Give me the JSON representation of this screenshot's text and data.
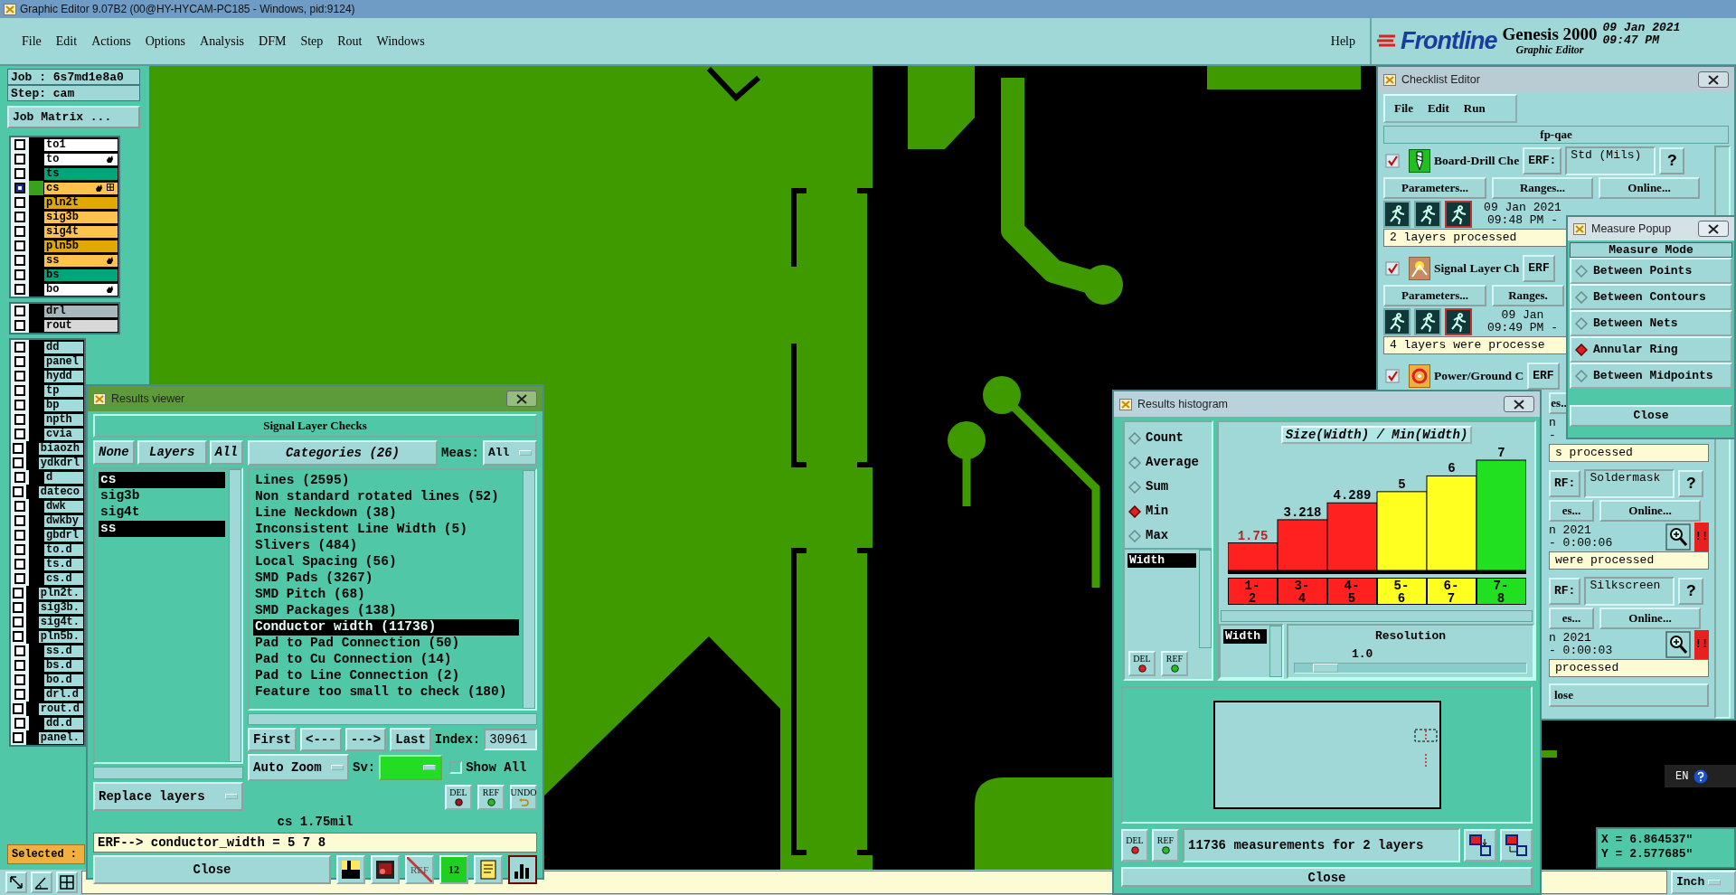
{
  "window": {
    "title": "Graphic Editor 9.07B2 (00@HY-HYCAM-PC185 - Windows, pid:9124)"
  },
  "menu": [
    "File",
    "Edit",
    "Actions",
    "Options",
    "Analysis",
    "DFM",
    "Step",
    "Rout",
    "Windows"
  ],
  "help_menu": "Help",
  "brand": {
    "logo": "Frontline",
    "product": "Genesis 2000",
    "subtitle": "Graphic Editor",
    "date": "09 Jan 2021",
    "time": "09:47 PM"
  },
  "job": {
    "job": "Job : 6s7md1e8a0",
    "step": "Step: cam",
    "matrix_button": "Job Matrix ..."
  },
  "layer_groups": [
    [
      {
        "name": "to1",
        "color": "#ffffff",
        "hand": false,
        "work": false
      },
      {
        "name": "to",
        "color": "#ffffff",
        "hand": true,
        "work": false
      },
      {
        "name": "ts",
        "color": "#00a57a",
        "hand": false,
        "work": false
      },
      {
        "name": "cs",
        "color": "#ffc34d",
        "hand": true,
        "work": true
      },
      {
        "name": "pln2t",
        "color": "#e0a800",
        "hand": false,
        "work": false
      },
      {
        "name": "sig3b",
        "color": "#ffc34d",
        "hand": false,
        "work": false
      },
      {
        "name": "sig4t",
        "color": "#ffc34d",
        "hand": false,
        "work": false
      },
      {
        "name": "pln5b",
        "color": "#e0a800",
        "hand": false,
        "work": false
      },
      {
        "name": "ss",
        "color": "#ffc34d",
        "hand": true,
        "work": false
      },
      {
        "name": "bs",
        "color": "#00a57a",
        "hand": false,
        "work": false
      },
      {
        "name": "bo",
        "color": "#ffffff",
        "hand": true,
        "work": false
      }
    ],
    [
      {
        "name": "drl",
        "color": "#a7b8bd",
        "hand": false,
        "work": false
      },
      {
        "name": "rout",
        "color": "#d8d8d8",
        "hand": false,
        "work": false
      }
    ],
    [
      {
        "name": "dd",
        "color": "#a0dcdc",
        "hand": false,
        "work": false
      },
      {
        "name": "panel",
        "color": "#a0dcdc",
        "hand": false,
        "work": false
      },
      {
        "name": "hydd",
        "color": "#a0dcdc",
        "hand": false,
        "work": false
      },
      {
        "name": "tp",
        "color": "#a0dcdc",
        "hand": false,
        "work": false
      },
      {
        "name": "bp",
        "color": "#a0dcdc",
        "hand": false,
        "work": false
      },
      {
        "name": "npth",
        "color": "#a0dcdc",
        "hand": false,
        "work": false
      },
      {
        "name": "cvia",
        "color": "#a0dcdc",
        "hand": false,
        "work": false
      },
      {
        "name": "biaozh",
        "color": "#a0dcdc",
        "hand": false,
        "work": false
      },
      {
        "name": "ydkdrl",
        "color": "#a0dcdc",
        "hand": false,
        "work": false
      },
      {
        "name": "d",
        "color": "#a0dcdc",
        "hand": false,
        "work": false
      },
      {
        "name": "dateco",
        "color": "#a0dcdc",
        "hand": false,
        "work": false
      },
      {
        "name": "dwk",
        "color": "#a0dcdc",
        "hand": false,
        "work": false
      },
      {
        "name": "dwkby",
        "color": "#a0dcdc",
        "hand": false,
        "work": false
      },
      {
        "name": "gbdrl",
        "color": "#a0dcdc",
        "hand": false,
        "work": false
      },
      {
        "name": "to.d",
        "color": "#a0dcdc",
        "hand": false,
        "work": false
      },
      {
        "name": "ts.d",
        "color": "#a0dcdc",
        "hand": false,
        "work": false
      },
      {
        "name": "cs.d",
        "color": "#a0dcdc",
        "hand": false,
        "work": false
      },
      {
        "name": "pln2t.",
        "color": "#a0dcdc",
        "hand": false,
        "work": false
      },
      {
        "name": "sig3b.",
        "color": "#a0dcdc",
        "hand": false,
        "work": false
      },
      {
        "name": "sig4t.",
        "color": "#a0dcdc",
        "hand": false,
        "work": false
      },
      {
        "name": "pln5b.",
        "color": "#a0dcdc",
        "hand": false,
        "work": false
      },
      {
        "name": "ss.d",
        "color": "#a0dcdc",
        "hand": false,
        "work": false
      },
      {
        "name": "bs.d",
        "color": "#a0dcdc",
        "hand": false,
        "work": false
      },
      {
        "name": "bo.d",
        "color": "#a0dcdc",
        "hand": false,
        "work": false
      },
      {
        "name": "drl.d",
        "color": "#a0dcdc",
        "hand": false,
        "work": false
      },
      {
        "name": "rout.d",
        "color": "#a0dcdc",
        "hand": false,
        "work": false
      },
      {
        "name": "dd.d",
        "color": "#a0dcdc",
        "hand": false,
        "work": false
      },
      {
        "name": "panel.",
        "color": "#a0dcdc",
        "hand": false,
        "work": false
      }
    ]
  ],
  "selected_label": "Selected :",
  "checklist_editor": {
    "title": "Checklist Editor",
    "menu": [
      "File",
      "Edit",
      "Run"
    ],
    "checklist": "fp-qae",
    "sections": [
      {
        "head": {
          "cut": false,
          "checked": true,
          "kind": "drill",
          "name": "Board-Drill Che",
          "erf_label": "ERF:",
          "erf": "Std (Mils)",
          "help": "?"
        },
        "buttons": {
          "cut": false,
          "items": [
            "Parameters...",
            "Ranges...",
            "Online..."
          ]
        },
        "run": {
          "cut": false,
          "date": "09 Jan 2021",
          "time": "09:48 PM -"
        },
        "status": {
          "cut": false,
          "text": "2 layers processed"
        }
      },
      {
        "head": {
          "cut": false,
          "checked": true,
          "kind": "signal",
          "name": "Signal Layer Ch",
          "erf_label": "ERF"
        },
        "buttons": {
          "cut": false,
          "items": [
            "Parameters...",
            "Ranges."
          ]
        },
        "run": {
          "cut": false,
          "date": "09 Jan",
          "time": "09:49 PM -"
        },
        "status": {
          "cut": false,
          "text": "4 layers were processe"
        }
      },
      {
        "head": {
          "cut": false,
          "checked": true,
          "kind": "power",
          "name": "Power/Ground C",
          "erf_label": "ERF"
        },
        "buttons": {
          "cut": true,
          "items": [
            "es.."
          ]
        },
        "run": {
          "cut": true,
          "date": "n",
          "time": "-"
        },
        "status": {
          "cut": true,
          "text": "s processed"
        }
      },
      {
        "head": {
          "cut": true,
          "erf_label": "RF:",
          "erf": "Soldermask",
          "help": "?"
        },
        "buttons": {
          "cut": true,
          "items": [
            "es...",
            "Online..."
          ]
        },
        "run": {
          "cut": true,
          "date": "n 2021",
          "time": "- 0:00:06",
          "alert": "!!"
        },
        "status": {
          "cut": true,
          "text": "were processed"
        }
      },
      {
        "head": {
          "cut": true,
          "erf_label": "RF:",
          "erf": "Silkscreen",
          "help": "?"
        },
        "buttons": {
          "cut": true,
          "items": [
            "es...",
            "Online..."
          ]
        },
        "run": {
          "cut": true,
          "date": "n 2021",
          "time": "- 0:00:03",
          "alert": "!!"
        },
        "status": {
          "cut": true,
          "text": "processed"
        }
      }
    ],
    "close": "lose"
  },
  "measure_popup": {
    "title": "Measure Popup",
    "header": "Measure Mode",
    "modes": [
      {
        "label": "Between Points",
        "selected": false
      },
      {
        "label": "Between Contours",
        "selected": false
      },
      {
        "label": "Between Nets",
        "selected": false
      },
      {
        "label": "Annular Ring",
        "selected": true
      },
      {
        "label": "Between Midpoints",
        "selected": false
      }
    ],
    "close": "Close"
  },
  "results_viewer": {
    "title": "Results viewer",
    "header": "Signal Layer Checks",
    "layer_buttons": [
      "None",
      "Layers",
      "All"
    ],
    "layers": [
      {
        "name": "cs",
        "selected": true
      },
      {
        "name": "sig3b",
        "selected": false
      },
      {
        "name": "sig4t",
        "selected": false
      },
      {
        "name": "ss",
        "selected": true
      }
    ],
    "replace": "Replace layers",
    "categories_button": "Categories (26)",
    "meas_label": "Meas:",
    "meas_value": "All",
    "categories": [
      {
        "name": "Lines (2595)",
        "selected": false
      },
      {
        "name": "Non standard rotated lines (52)",
        "selected": false
      },
      {
        "name": "Line Neckdown (38)",
        "selected": false
      },
      {
        "name": "Inconsistent Line Width (5)",
        "selected": false
      },
      {
        "name": "Slivers (484)",
        "selected": false
      },
      {
        "name": "Local Spacing (56)",
        "selected": false
      },
      {
        "name": "SMD Pads (3267)",
        "selected": false
      },
      {
        "name": "SMD Pitch (68)",
        "selected": false
      },
      {
        "name": "SMD Packages (138)",
        "selected": false
      },
      {
        "name": "Conductor width (11736)",
        "selected": true
      },
      {
        "name": "Pad to Pad Connection (50)",
        "selected": false
      },
      {
        "name": "Pad to Cu Connection (14)",
        "selected": false
      },
      {
        "name": "Pad to Line Connection (2)",
        "selected": false
      },
      {
        "name": "Feature too small to check (180)",
        "selected": false
      }
    ],
    "nav": [
      "First",
      "<---",
      "--->",
      "Last"
    ],
    "index_label": "Index:",
    "index": "30961",
    "zoom": "Auto Zoom",
    "sv_label": "Sv:",
    "show_all": {
      "label": "Show All",
      "checked": false
    },
    "edit_buttons": [
      {
        "kind": "del",
        "label": "DEL"
      },
      {
        "kind": "ref",
        "label": "REF"
      },
      {
        "kind": "undo",
        "label": "UNDO"
      }
    ],
    "measurement": "cs 1.75mil",
    "erf": "ERF--> conductor_width = 5 7 8",
    "close": "Close",
    "tools": [
      {
        "kind": "layer",
        "selected": false
      },
      {
        "kind": "erase",
        "selected": false
      },
      {
        "kind": "ref_off",
        "label": "REF",
        "selected": false
      },
      {
        "kind": "numbers",
        "label": "12",
        "selected": false
      },
      {
        "kind": "report",
        "selected": false
      },
      {
        "kind": "histogram",
        "selected": true
      }
    ]
  },
  "histogram": {
    "title": "Results histogram",
    "modes": [
      {
        "label": "Count",
        "selected": false
      },
      {
        "label": "Average",
        "selected": false
      },
      {
        "label": "Sum",
        "selected": false
      },
      {
        "label": "Min",
        "selected": true
      },
      {
        "label": "Max",
        "selected": false
      }
    ],
    "fields": [
      {
        "label": "Width",
        "selected": true
      }
    ],
    "del": "DEL",
    "ref": "REF",
    "bins": [
      {
        "color": "#ff2020",
        "flagged": true
      },
      {
        "color": "#ff2020",
        "flagged": false
      },
      {
        "color": "#ff2020",
        "flagged": false
      },
      {
        "color": "#ffff20",
        "flagged": false
      },
      {
        "color": "#ffff20",
        "flagged": false
      },
      {
        "color": "#20e020",
        "flagged": false
      }
    ],
    "chart_data": {
      "type": "bar",
      "title": "Size(Width) / Min(Width)",
      "categories": [
        "1-2",
        "3-4",
        "4-5",
        "5-6",
        "6-7",
        "7-8"
      ],
      "values": [
        1.75,
        3.218,
        4.289,
        5,
        6,
        7
      ],
      "data_labels": true
    },
    "x_fields": [
      {
        "label": "Width",
        "selected": true
      }
    ],
    "resolution": {
      "label": "Resolution",
      "value": "1.0",
      "level": 0.08
    },
    "summary_del": "DEL",
    "summary_ref": "REF",
    "summary": "11736 measurements for 2 layers",
    "close": "Close"
  },
  "coordinates": {
    "x": "X = 6.864537\"",
    "y": "Y = 2.577685\""
  },
  "language": "EN",
  "units": "Inch"
}
